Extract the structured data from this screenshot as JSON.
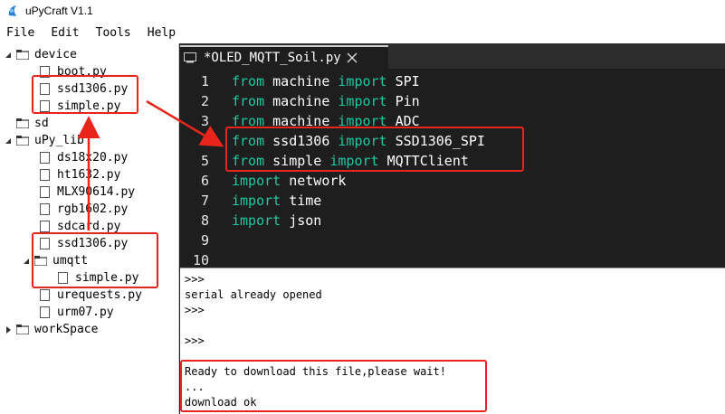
{
  "window": {
    "title": "uPyCraft V1.1",
    "icon": "upycraft-logo-icon"
  },
  "menu": {
    "items": [
      "File",
      "Edit",
      "Tools",
      "Help"
    ]
  },
  "sidebar": {
    "device": {
      "label": "device",
      "files": [
        "boot.py",
        "ssd1306.py",
        "simple.py"
      ]
    },
    "sd": {
      "label": "sd"
    },
    "upy_lib": {
      "label": "uPy_lib",
      "files": [
        "ds18x20.py",
        "ht1632.py",
        "MLX90614.py",
        "rgb1602.py",
        "sdcard.py",
        "ssd1306.py"
      ],
      "umqtt": {
        "label": "umqtt",
        "files": [
          "simple.py"
        ]
      },
      "files_after": [
        "urequests.py",
        "urm07.py"
      ]
    },
    "workspace": {
      "label": "workSpace"
    }
  },
  "editor": {
    "tab_label": "*OLED_MQTT_Soil.py",
    "lines": [
      {
        "no": "1",
        "kw1": "from",
        "mod": " machine ",
        "kw2": "import",
        "name": " SPI"
      },
      {
        "no": "2",
        "kw1": "from",
        "mod": " machine ",
        "kw2": "import",
        "name": " Pin"
      },
      {
        "no": "3",
        "kw1": "from",
        "mod": " machine ",
        "kw2": "import",
        "name": " ADC"
      },
      {
        "no": "4",
        "kw1": "from",
        "mod": " ssd1306 ",
        "kw2": "import",
        "name": " SSD1306_SPI"
      },
      {
        "no": "5",
        "kw1": "from",
        "mod": " simple ",
        "kw2": "import",
        "name": " MQTTClient"
      },
      {
        "no": "6",
        "kw1": "import",
        "mod": " network",
        "kw2": "",
        "name": ""
      },
      {
        "no": "7",
        "kw1": "import",
        "mod": " time",
        "kw2": "",
        "name": ""
      },
      {
        "no": "8",
        "kw1": "import",
        "mod": " json",
        "kw2": "",
        "name": ""
      },
      {
        "no": "9",
        "kw1": "",
        "mod": "",
        "kw2": "",
        "name": ""
      },
      {
        "no": "10",
        "kw1": "",
        "mod": "",
        "kw2": "",
        "name": ""
      }
    ]
  },
  "console": {
    "lines": [
      ">>>",
      "serial already opened",
      ">>>",
      "",
      ">>>",
      "",
      "Ready to download this file,please wait!",
      "...",
      "download ok"
    ]
  },
  "colors": {
    "keyword": "#1ec8a0",
    "annotation": "#e8251c",
    "editor_bg": "#1e1e1e"
  }
}
